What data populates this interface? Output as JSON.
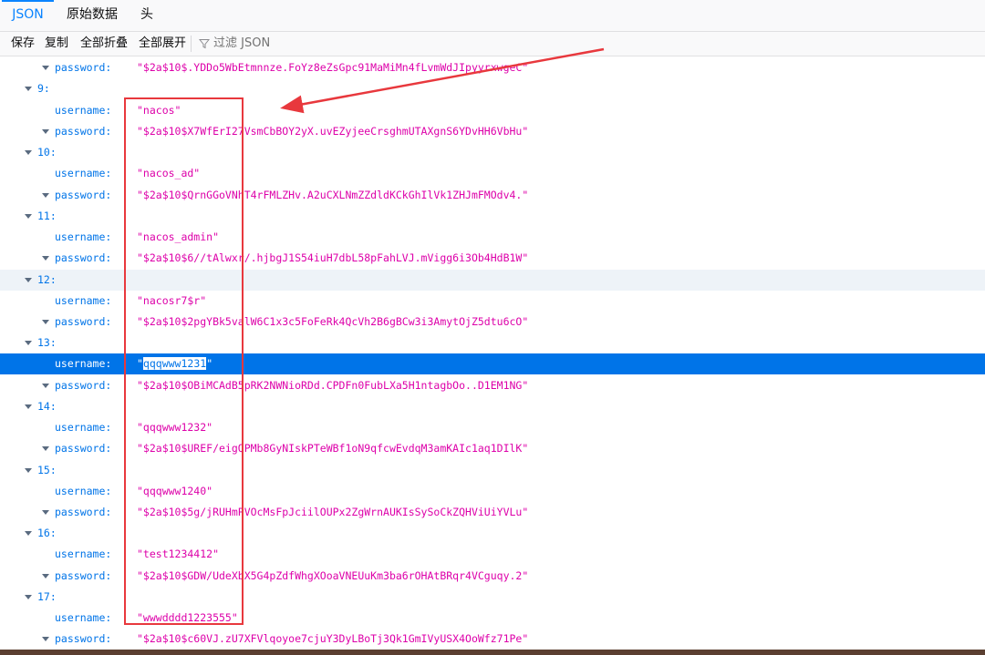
{
  "tabs": [
    {
      "label": "JSON",
      "active": true
    },
    {
      "label": "原始数据",
      "active": false
    },
    {
      "label": "头",
      "active": false
    }
  ],
  "toolbar": {
    "save": "保存",
    "copy": "复制",
    "collapse_all": "全部折叠",
    "expand_all": "全部展开",
    "filter_placeholder": "过滤 JSON"
  },
  "tree": {
    "top_password": {
      "key": "password:",
      "value": "\"$2a$10$.YDDo5WbEtmnnze.FoYz8eZsGpc91MaMiMn4fLvmWdJIpyyrxwgeC\""
    },
    "items": [
      {
        "index": "9:",
        "username": "\"nacos\"",
        "password": "\"$2a$10$X7WfErI27VsmCbBOY2yX.uvEZyjeeCrsghmUTAXgnS6YDvHH6VbHu\""
      },
      {
        "index": "10:",
        "username": "\"nacos_ad\"",
        "password": "\"$2a$10$QrnGGoVNhT4rFMLZHv.A2uCXLNmZZdldKCkGhIlVk1ZHJmFMOdv4.\""
      },
      {
        "index": "11:",
        "username": "\"nacos_admin\"",
        "password": "\"$2a$10$6//tAlwxr/.hjbgJ1S54iuH7dbL58pFahLVJ.mVigg6i3Ob4HdB1W\""
      },
      {
        "index": "12:",
        "username": "\"nacosr7$r\"",
        "password": "\"$2a$10$2pgYBk5valW6C1x3c5FoFeRk4QcVh2B6gBCw3i3AmytOjZ5dtu6cO\""
      },
      {
        "index": "13:",
        "username_text": "qqqwww1231",
        "password": "\"$2a$10$OBiMCAdB5pRK2NWNioRDd.CPDFn0FubLXa5H1ntagbOo..D1EM1NG\""
      },
      {
        "index": "14:",
        "username": "\"qqqwww1232\"",
        "password": "\"$2a$10$UREF/eigQPMb8GyNIskPTeWBf1oN9qfcwEvdqM3amKAIc1aq1DIlK\""
      },
      {
        "index": "15:",
        "username": "\"qqqwww1240\"",
        "password": "\"$2a$10$5g/jRUHmPVOcMsFpJciilOUPx2ZgWrnAUKIsSySoCkZQHViUiYVLu\""
      },
      {
        "index": "16:",
        "username": "\"test1234412\"",
        "password": "\"$2a$10$GDW/UdeXbX5G4pZdfWhgXOoaVNEUuKm3ba6rOHAtBRqr4VCguqy.2\""
      },
      {
        "index": "17:",
        "username": "\"wwwdddd1223555\"",
        "password": "\"$2a$10$c60VJ.zU7XFVlqoyoe7cjuY3DyLBoTj3Qk1GmIVyUSX4OoWfz71Pe\""
      }
    ],
    "username_key": "username:",
    "password_key": "password:",
    "quote": "\""
  },
  "colors": {
    "accent": "#0a84ff",
    "key": "#0074e8",
    "string": "#dd00a9",
    "selection": "#0074e8",
    "annotation": "#e8383d"
  }
}
